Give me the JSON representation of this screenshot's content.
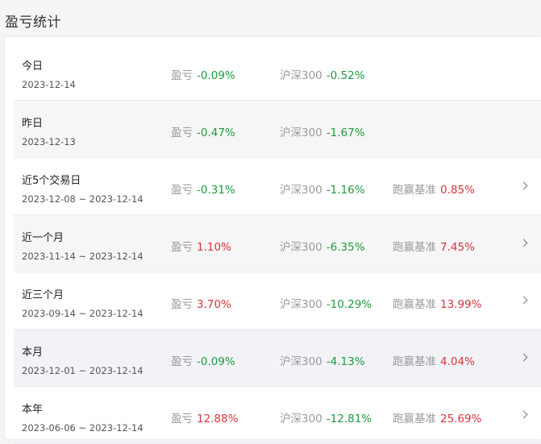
{
  "page_title": "盈亏统计",
  "labels": {
    "pnl": "盈亏",
    "index": "沪深300",
    "excess": "跑赢基准"
  },
  "rows": [
    {
      "name": "今日",
      "date": "2023-12-14",
      "pnl": "-0.09%",
      "index": "-0.52%",
      "excess": null
    },
    {
      "name": "昨日",
      "date": "2023-12-13",
      "pnl": "-0.47%",
      "index": "-1.67%",
      "excess": null
    },
    {
      "name": "近5个交易日",
      "date": "2023-12-08 ~ 2023-12-14",
      "pnl": "-0.31%",
      "index": "-1.16%",
      "excess": "0.85%"
    },
    {
      "name": "近一个月",
      "date": "2023-11-14 ~ 2023-12-14",
      "pnl": "1.10%",
      "index": "-6.35%",
      "excess": "7.45%"
    },
    {
      "name": "近三个月",
      "date": "2023-09-14 ~ 2023-12-14",
      "pnl": "3.70%",
      "index": "-10.29%",
      "excess": "13.99%"
    },
    {
      "name": "本月",
      "date": "2023-12-01 ~ 2023-12-14",
      "pnl": "-0.09%",
      "index": "-4.13%",
      "excess": "4.04%"
    },
    {
      "name": "本年",
      "date": "2023-06-06 ~ 2023-12-14",
      "pnl": "12.88%",
      "index": "-12.81%",
      "excess": "25.69%"
    }
  ],
  "colors": {
    "negative": "#1f9a3c",
    "positive": "#d8343c"
  }
}
